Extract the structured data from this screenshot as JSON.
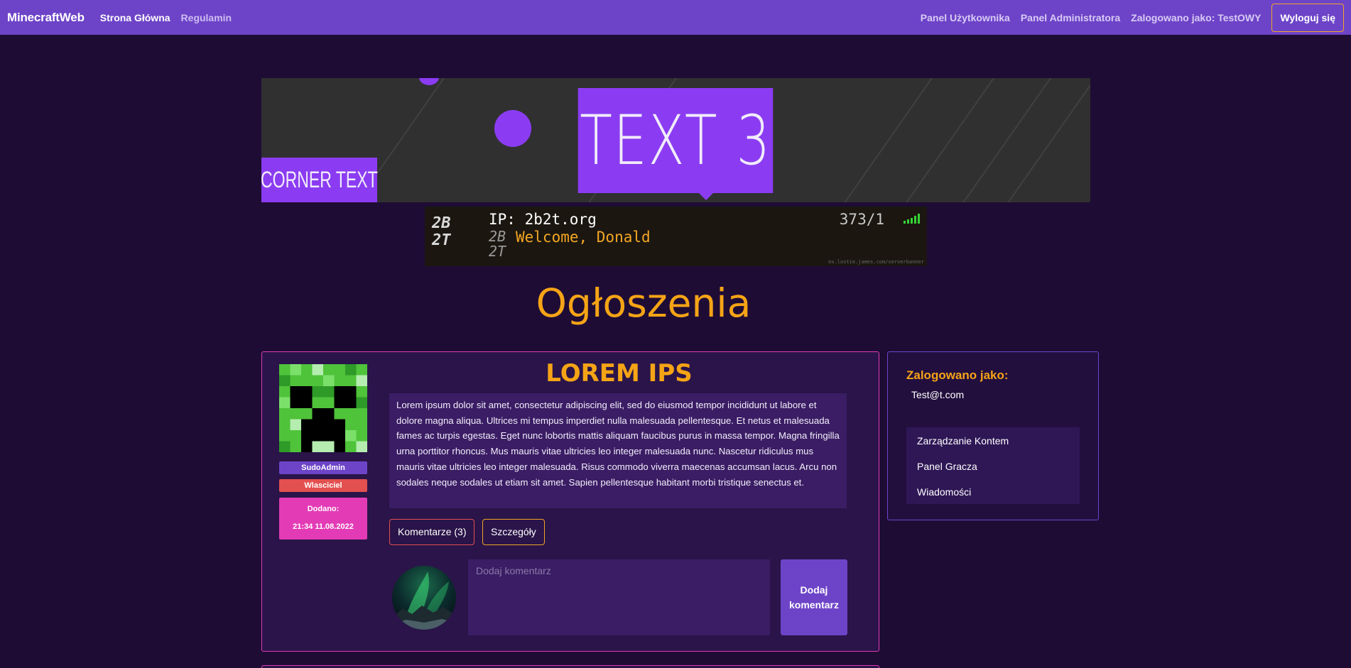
{
  "navbar": {
    "brand": "MinecraftWeb",
    "links": [
      "Strona Główna",
      "Regulamin"
    ],
    "right_links": [
      "Panel Użytkownika",
      "Panel Administratora",
      "Zalogowano jako: TestOWY"
    ],
    "logout_label": "Wyloguj się"
  },
  "banner_top": {
    "main_text": "TEXT 3",
    "corner_text": "CORNER TEXT"
  },
  "server_banner": {
    "logo_lines": [
      "2B",
      "2T"
    ],
    "ip": "IP: 2b2t.org",
    "players": "373/1",
    "motd_prefix_lines": [
      "2B",
      "2T"
    ],
    "motd": "Welcome, Donald",
    "credit": "ex.lostie.james.com/serverbanner"
  },
  "page": {
    "title": "Ogłoszenia"
  },
  "post": {
    "title": "LOREM IPS",
    "role_badge": "SudoAdmin",
    "owner_badge": "Wlasciciel",
    "added_label": "Dodano:",
    "added_date": "21:34 11.08.2022",
    "body": "Lorem ipsum dolor sit amet, consectetur adipiscing elit, sed do eiusmod tempor incididunt ut labore et dolore magna aliqua. Ultrices mi tempus imperdiet nulla malesuada pellentesque. Et netus et malesuada fames ac turpis egestas. Eget nunc lobortis mattis aliquam faucibus purus in massa tempor. Magna fringilla urna porttitor rhoncus. Mus mauris vitae ultricies leo integer malesuada nunc. Nascetur ridiculus mus mauris vitae ultricies leo integer malesuada. Risus commodo viverra maecenas accumsan lacus. Arcu non sodales neque sodales ut etiam sit amet. Sapien pellentesque habitant morbi tristique senectus et.",
    "comments_button": "Komentarze (3)",
    "details_button": "Szczegóły",
    "comment_placeholder": "Dodaj komentarz",
    "add_comment_button": "Dodaj komentarz"
  },
  "sidebar": {
    "title": "Zalogowano jako:",
    "user_email": "Test@t.com",
    "menu": [
      "Zarządzanie Kontem",
      "Panel Gracza",
      "Wiadomości"
    ]
  },
  "colors": {
    "background": "#1f0c35",
    "navbar": "#6d44c8",
    "accent_orange": "#f5a416",
    "accent_pink": "#e33bb5",
    "accent_red": "#e35050",
    "panel": "#3a1d64"
  },
  "icons": {
    "signal": "signal-bars-icon",
    "creeper": "creeper-avatar",
    "aurora": "aurora-avatar"
  }
}
